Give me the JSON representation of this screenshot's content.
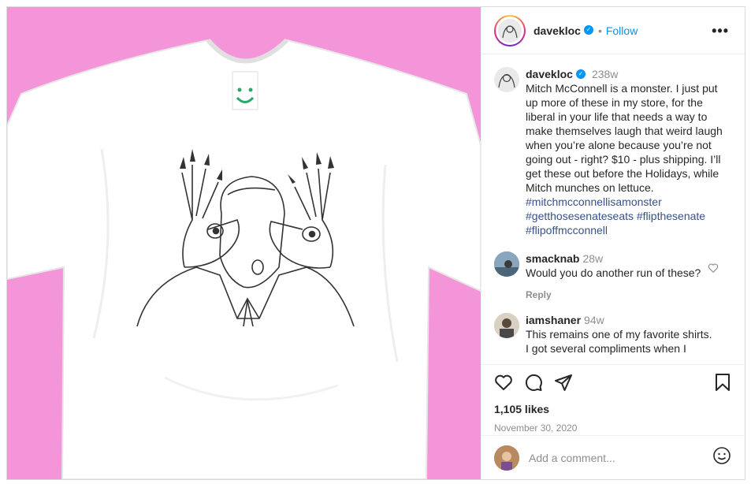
{
  "post": {
    "author": "davekloc",
    "follow_label": "Follow",
    "more_label": "•••",
    "separator": "•"
  },
  "caption": {
    "username": "davekloc",
    "time": "238w",
    "text": "Mitch McConnell is a monster.  I just put up more of these in my store, for the liberal in your life that needs a way to make themselves laugh that weird laugh when you’re alone because you’re not going out - right? $10 - plus shipping.  I’ll get these out before the Holidays, while Mitch munches on lettuce.",
    "hashtags": [
      "#mitchmcconnellisamonster",
      "#getthosesenateseats #flipthesenate",
      "#flipoffmcconnell"
    ]
  },
  "comments": [
    {
      "username": "smacknab",
      "time": "28w",
      "text": "Would you do another run of these?",
      "reply_label": "Reply"
    },
    {
      "username": "iamshaner",
      "time": "94w",
      "text": "This remains one of my favorite shirts.",
      "overflow_text": "I got several compliments when I"
    }
  ],
  "stats": {
    "likes": "1,105 likes",
    "date": "November 30, 2020"
  },
  "composer": {
    "placeholder": "Add a comment..."
  },
  "icons": [
    "verified-badge-icon",
    "more-options-icon",
    "heart-icon",
    "comment-icon",
    "share-icon",
    "bookmark-icon",
    "emoji-icon"
  ],
  "colors": {
    "background_pink": "#f595d9",
    "link_blue": "#0095f6",
    "hashtag_blue": "#385185",
    "muted": "#8e8e8e"
  }
}
